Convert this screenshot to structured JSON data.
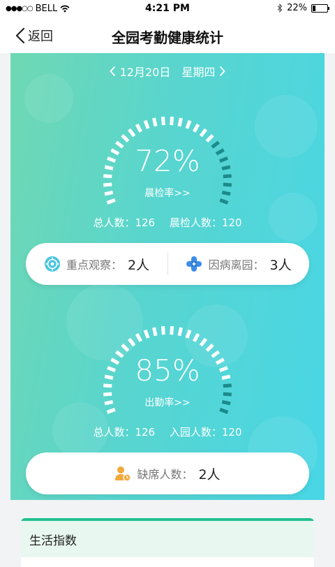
{
  "status_bar": {
    "carrier": "BELL",
    "time": "4:21 PM",
    "battery": "22%",
    "battery_level": 0.22
  },
  "nav": {
    "back_label": "返回",
    "title": "全园考勤健康统计"
  },
  "date": {
    "label": "12月20日",
    "weekday": "星期四"
  },
  "morning_check": {
    "percent": "72%",
    "rate": 0.72,
    "label": "晨检率>>",
    "total_label": "总人数：126",
    "checked_label": "晨检人数：120"
  },
  "observation": {
    "key_label": "重点观察：",
    "key_value": "2人",
    "sick_label": "因病离园：",
    "sick_value": "3人"
  },
  "attendance": {
    "percent": "85%",
    "rate": 0.85,
    "label": "出勤率>>",
    "total_label": "总人数：126",
    "entered_label": "入园人数：120"
  },
  "absence": {
    "label": "缺席人数：",
    "value": "2人"
  },
  "life_index": {
    "title": "生活指数"
  },
  "colors": {
    "gradient_start": "#6fd8b3",
    "gradient_end": "#49d6e6",
    "gauge_dark": "#1c8a8a",
    "accent_green": "#21c08f",
    "observe_icon": "#4cc4e0",
    "sick_icon": "#3b8ee8",
    "absence_icon": "#f2a93b"
  }
}
